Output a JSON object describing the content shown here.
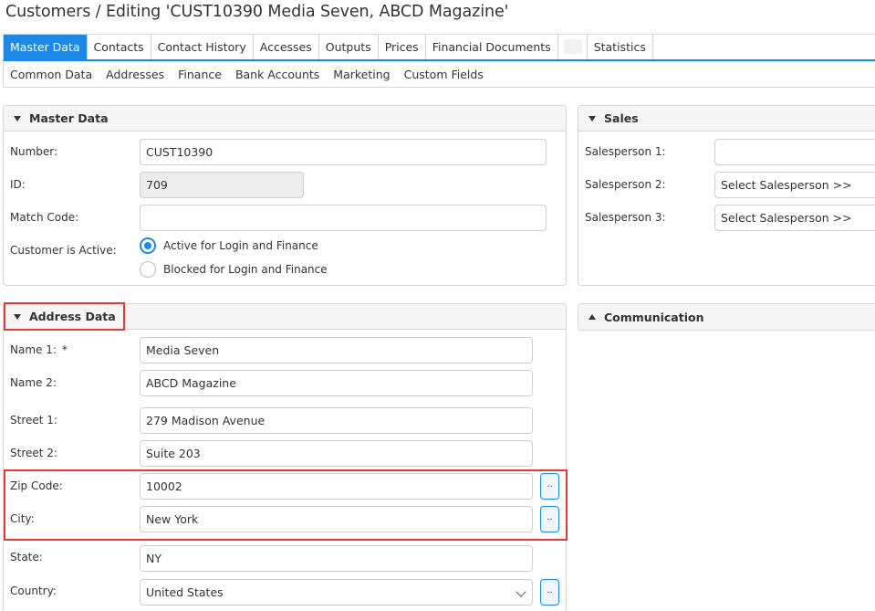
{
  "page": {
    "title": "Customers / Editing 'CUST10390 Media Seven, ABCD Magazine'"
  },
  "tabs": [
    {
      "label": "Master Data",
      "active": true
    },
    {
      "label": "Contacts"
    },
    {
      "label": "Contact History"
    },
    {
      "label": "Accesses"
    },
    {
      "label": "Outputs"
    },
    {
      "label": "Prices"
    },
    {
      "label": "Financial Documents"
    },
    {
      "label": ""
    },
    {
      "label": "Statistics"
    }
  ],
  "subtabs": [
    "Common Data",
    "Addresses",
    "Finance",
    "Bank Accounts",
    "Marketing",
    "Custom Fields"
  ],
  "master": {
    "header": "Master Data",
    "number_label": "Number:",
    "number_value": "CUST10390",
    "id_label": "ID:",
    "id_value": "709",
    "match_label": "Match Code:",
    "match_value": "",
    "active_label": "Customer is Active:",
    "radio_active": "Active for Login and Finance",
    "radio_blocked": "Blocked for Login and Finance"
  },
  "sales": {
    "header": "Sales",
    "sp1_label": "Salesperson 1:",
    "sp1_value": "",
    "sp2_label": "Salesperson 2:",
    "sp2_value": "Select Salesperson >>",
    "sp3_label": "Salesperson 3:",
    "sp3_value": "Select Salesperson >>"
  },
  "address": {
    "header": "Address Data",
    "name1_label": "Name 1:",
    "required_mark": "*",
    "name1_value": "Media Seven",
    "name2_label": "Name 2:",
    "name2_value": "ABCD Magazine",
    "street1_label": "Street 1:",
    "street1_value": "279 Madison Avenue",
    "street2_label": "Street 2:",
    "street2_value": "Suite 203",
    "zip_label": "Zip Code:",
    "zip_value": "10002",
    "city_label": "City:",
    "city_value": "New York",
    "state_label": "State:",
    "state_value": "NY",
    "country_label": "Country:",
    "country_value": "United States",
    "dots": ".."
  },
  "communication": {
    "header": "Communication"
  },
  "colors": {
    "accent": "#1e88e5",
    "highlight": "#e53935"
  }
}
